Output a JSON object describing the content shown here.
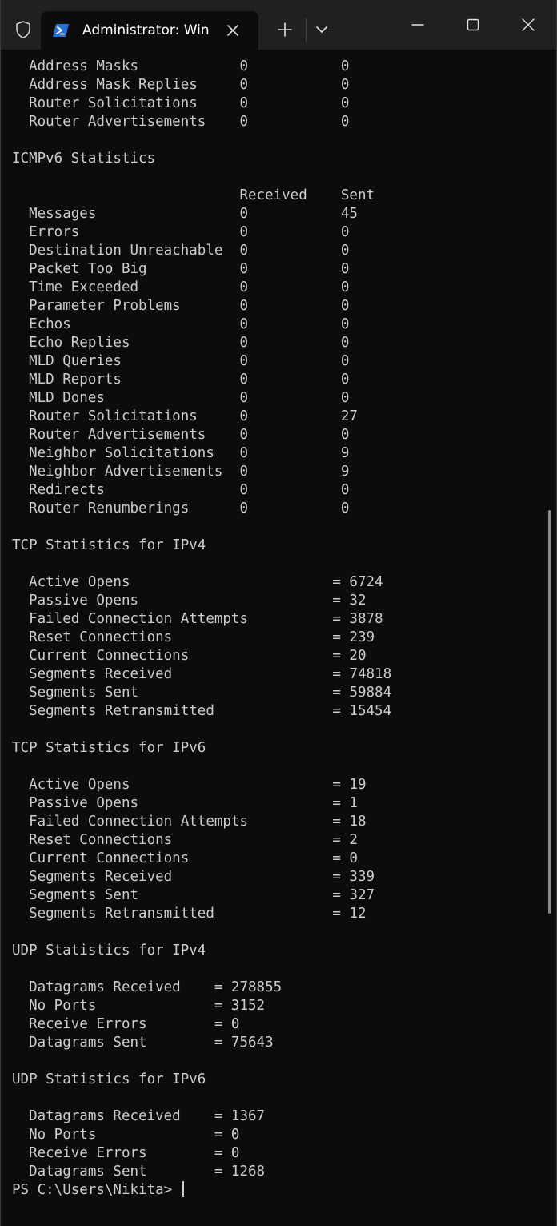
{
  "window": {
    "tab_title": "Administrator: Win"
  },
  "console": {
    "lines": [
      "  Address Masks            0           0",
      "  Address Mask Replies     0           0",
      "  Router Solicitations     0           0",
      "  Router Advertisements    0           0",
      "",
      "ICMPv6 Statistics",
      "",
      "                           Received    Sent",
      "  Messages                 0           45",
      "  Errors                   0           0",
      "  Destination Unreachable  0           0",
      "  Packet Too Big           0           0",
      "  Time Exceeded            0           0",
      "  Parameter Problems       0           0",
      "  Echos                    0           0",
      "  Echo Replies             0           0",
      "  MLD Queries              0           0",
      "  MLD Reports              0           0",
      "  MLD Dones                0           0",
      "  Router Solicitations     0           27",
      "  Router Advertisements    0           0",
      "  Neighbor Solicitations   0           9",
      "  Neighbor Advertisements  0           9",
      "  Redirects                0           0",
      "  Router Renumberings      0           0",
      "",
      "TCP Statistics for IPv4",
      "",
      "  Active Opens                        = 6724",
      "  Passive Opens                       = 32",
      "  Failed Connection Attempts          = 3878",
      "  Reset Connections                   = 239",
      "  Current Connections                 = 20",
      "  Segments Received                   = 74818",
      "  Segments Sent                       = 59884",
      "  Segments Retransmitted              = 15454",
      "",
      "TCP Statistics for IPv6",
      "",
      "  Active Opens                        = 19",
      "  Passive Opens                       = 1",
      "  Failed Connection Attempts          = 18",
      "  Reset Connections                   = 2",
      "  Current Connections                 = 0",
      "  Segments Received                   = 339",
      "  Segments Sent                       = 327",
      "  Segments Retransmitted              = 12",
      "",
      "UDP Statistics for IPv4",
      "",
      "  Datagrams Received    = 278855",
      "  No Ports              = 3152",
      "  Receive Errors        = 0",
      "  Datagrams Sent        = 75643",
      "",
      "UDP Statistics for IPv6",
      "",
      "  Datagrams Received    = 1367",
      "  No Ports              = 0",
      "  Receive Errors        = 0",
      "  Datagrams Sent        = 1268"
    ],
    "prompt": "PS C:\\Users\\Nikita> "
  },
  "icons": {
    "shield": "shield-icon",
    "powershell": "powershell-icon",
    "tab_close": "close-icon",
    "new_tab": "plus-icon",
    "dropdown": "chevron-down-icon",
    "minimize": "minimize-icon",
    "maximize": "maximize-icon",
    "close": "close-icon"
  },
  "colors": {
    "background": "#0c0c0c",
    "titlebar": "#202020",
    "text": "#cccccc",
    "powershell_blue": "#2b6fd8"
  }
}
